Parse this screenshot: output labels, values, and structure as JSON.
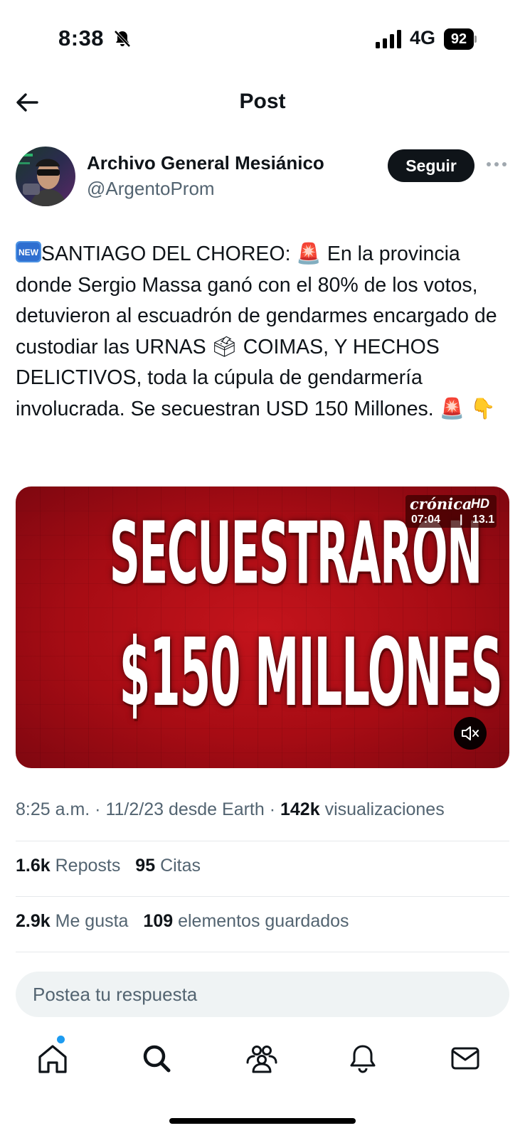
{
  "status_bar": {
    "time": "8:38",
    "network": "4G",
    "battery": "92"
  },
  "header": {
    "title": "Post"
  },
  "author": {
    "name": "Archivo General Mesiánico",
    "handle": "@ArgentoProm",
    "follow_label": "Seguir"
  },
  "tweet": {
    "new_badge": "NEW",
    "text_1": "SANTIAGO DEL CHOREO: ",
    "text_2": " En la provincia donde Sergio Massa ganó con el 80% de los votos, detuvieron al escuadrón de gendarmes encargado de custodiar las URNAS ",
    "text_3": " COIMAS, Y HECHOS DELICTIVOS, toda la cúpula de gendarmería involucrada. Se secuestran USD 150 Millones. ",
    "emoji_siren": "🚨",
    "emoji_ballot": "🗳",
    "emoji_point_down": "👇"
  },
  "media": {
    "headline_1": "SECUESTRARON",
    "headline_2": "$150 MILLONES",
    "logo_text": "crónica",
    "logo_hd": "HD",
    "logo_time": "07:04",
    "logo_sep": "|",
    "logo_channel": "13.1"
  },
  "meta": {
    "time": "8:25 a.m.",
    "sep_1": " · ",
    "date": "11/2/23",
    "source": " desde Earth",
    "sep_2": " · ",
    "views_count": "142k",
    "views_label": " visualizaciones"
  },
  "stats": {
    "reposts_count": "1.6k",
    "reposts_label": "Reposts",
    "quotes_count": "95",
    "quotes_label": "Citas",
    "likes_count": "2.9k",
    "likes_label": "Me gusta",
    "bookmarks_count": "109",
    "bookmarks_label": "elementos guardados"
  },
  "reply": {
    "placeholder": "Postea tu respuesta"
  },
  "nav": {
    "icons": [
      "home-icon",
      "search-icon",
      "communities-icon",
      "notifications-icon",
      "messages-icon"
    ],
    "accent_color": "#1d9bf0"
  },
  "colors": {
    "text": "#0f1419",
    "secondary": "#536471",
    "media_red": "#b0101a"
  }
}
